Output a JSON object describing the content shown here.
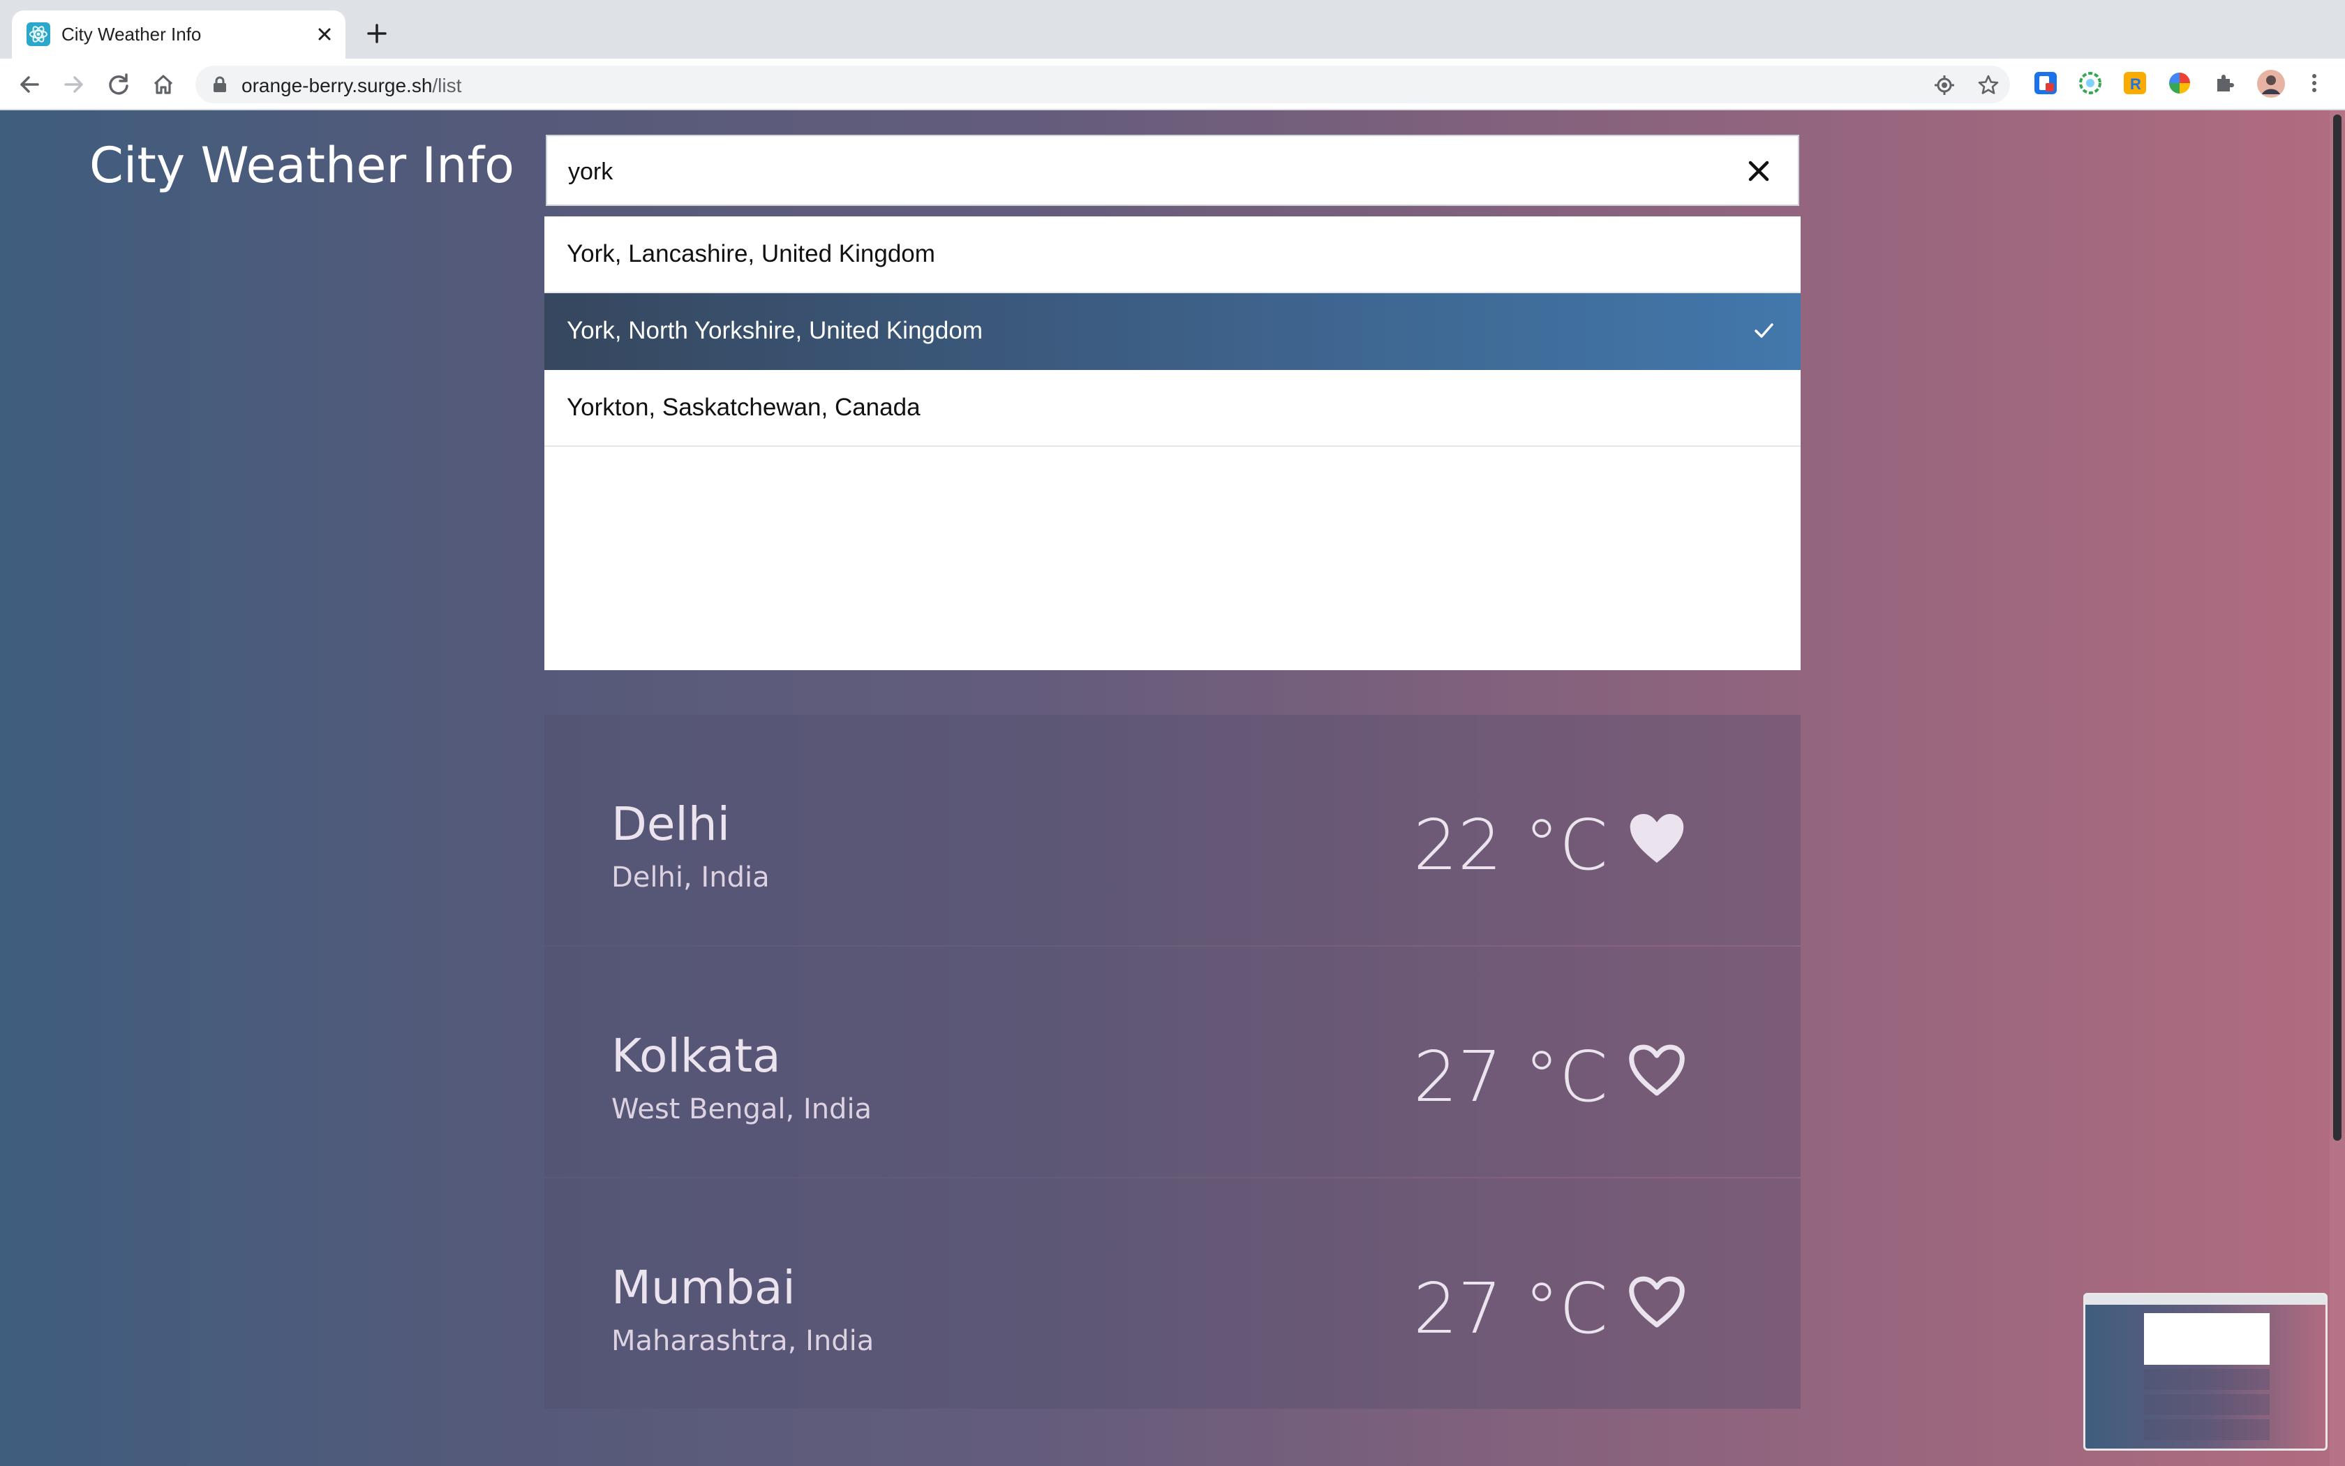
{
  "browser": {
    "tab_title": "City Weather Info",
    "url_host": "orange-berry.surge.sh",
    "url_path": "/list",
    "icons": [
      "react-favicon-icon",
      "close-tab-icon",
      "new-tab-icon",
      "back-icon",
      "forward-icon",
      "reload-icon",
      "home-icon",
      "lock-icon",
      "location-icon",
      "bookmark-star-icon",
      "extensions-icon",
      "profile-avatar",
      "menu-icon"
    ]
  },
  "app": {
    "title": "City Weather Info"
  },
  "search": {
    "value": "york"
  },
  "dropdown": {
    "options": [
      {
        "label": "York, Lancashire, United Kingdom",
        "selected": false
      },
      {
        "label": "York, North Yorkshire, United Kingdom",
        "selected": true
      },
      {
        "label": "Yorkton, Saskatchewan, Canada",
        "selected": false
      }
    ]
  },
  "cities": [
    {
      "city": "Delhi",
      "region": "Delhi, India",
      "temp": "22 °C",
      "favorite": true
    },
    {
      "city": "Kolkata",
      "region": "West Bengal, India",
      "temp": "27 °C",
      "favorite": false
    },
    {
      "city": "Mumbai",
      "region": "Maharashtra, India",
      "temp": "27 °C",
      "favorite": false
    }
  ],
  "colors": {
    "selected_option": "#3d5f86",
    "page_gradient_left": "#3f5d7e",
    "page_gradient_right": "#b16c80"
  }
}
